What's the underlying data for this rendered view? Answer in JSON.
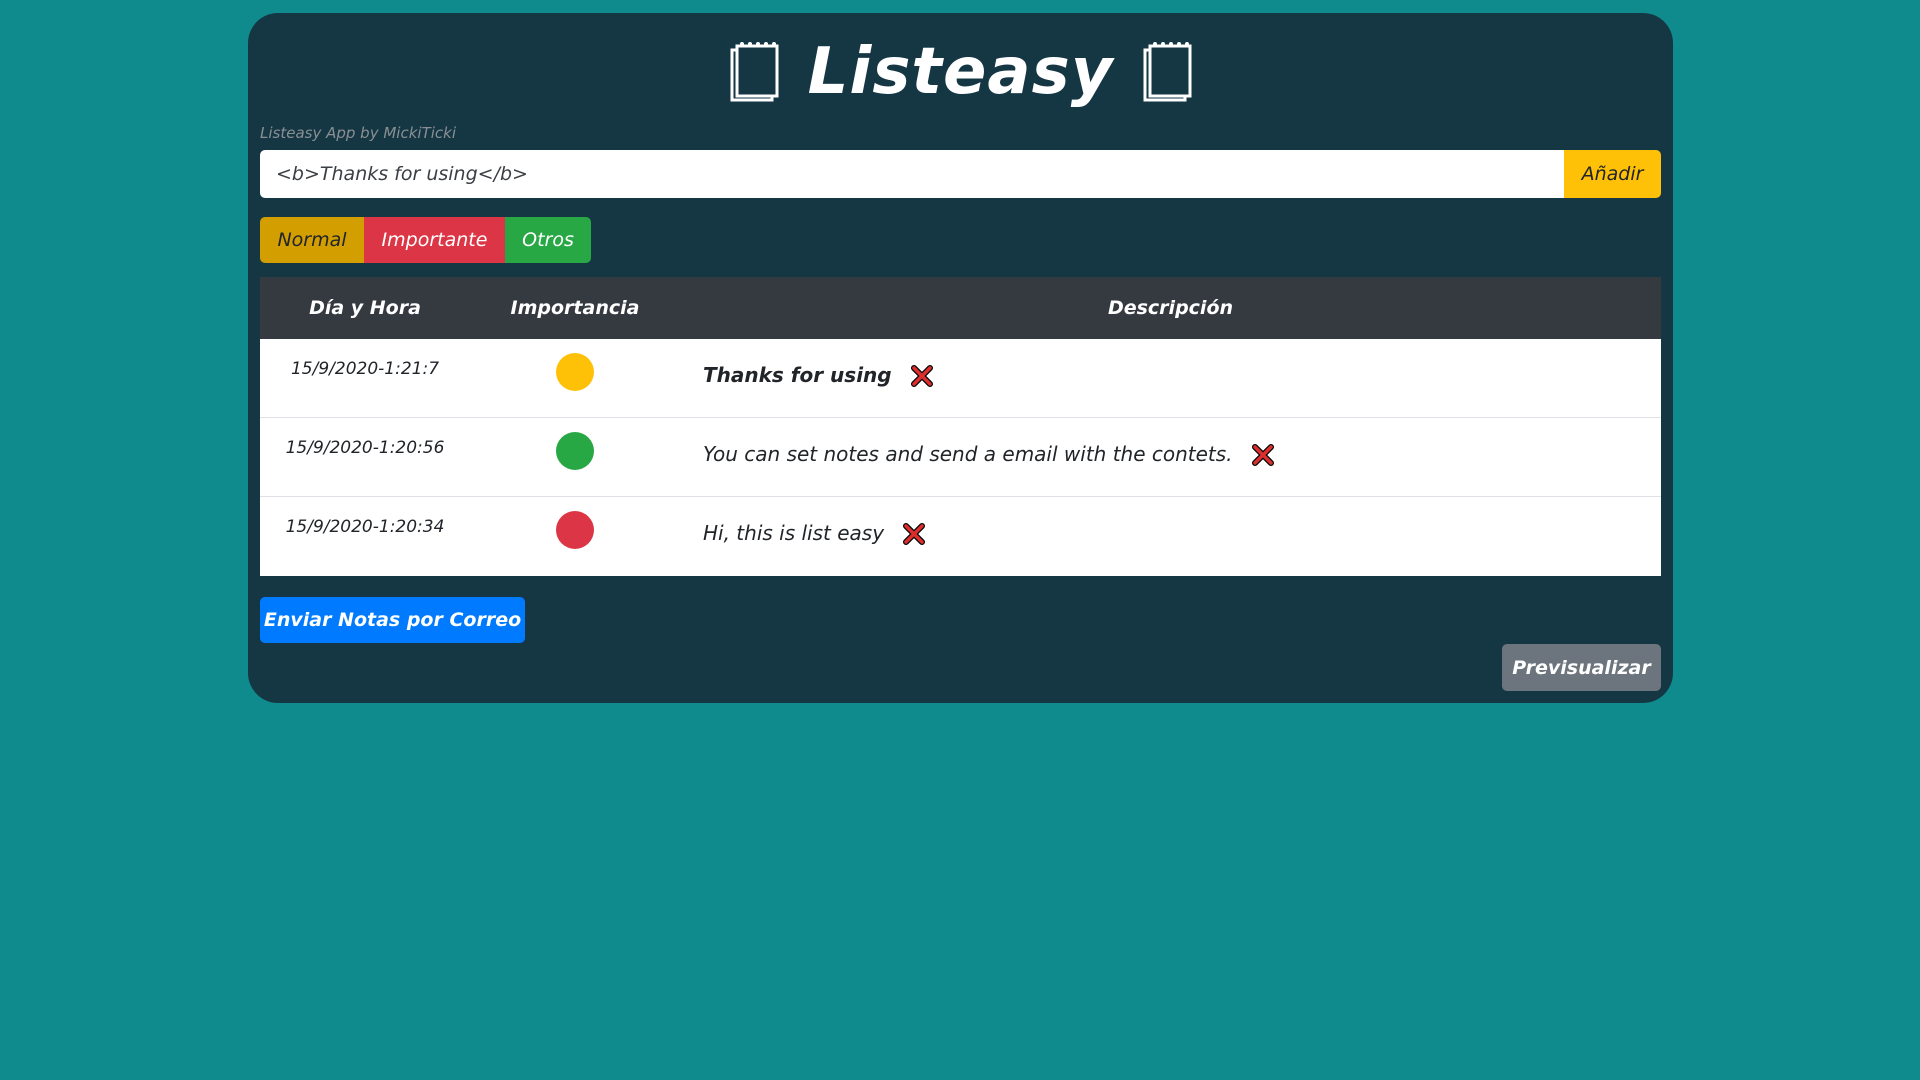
{
  "app": {
    "title": "Listeasy",
    "credit": "Listeasy App by MickiTicki"
  },
  "input": {
    "value": "<b>Thanks for using</b>",
    "add_label": "Añadir"
  },
  "priority_buttons": {
    "normal": "Normal",
    "importante": "Importante",
    "otros": "Otros"
  },
  "table": {
    "headers": {
      "date": "Día y Hora",
      "importance": "Importancia",
      "description": "Descripción"
    },
    "rows": [
      {
        "date": "15/9/2020-1:21:7",
        "importance": "normal",
        "importance_color": "#ffc107",
        "description": "Thanks for using",
        "bold": true
      },
      {
        "date": "15/9/2020-1:20:56",
        "importance": "otros",
        "importance_color": "#28a745",
        "description": "You can set notes and send a email with the contets.",
        "bold": false
      },
      {
        "date": "15/9/2020-1:20:34",
        "importance": "importante",
        "importance_color": "#dc3545",
        "description": "Hi, this is list easy",
        "bold": false
      }
    ]
  },
  "actions": {
    "send_mail": "Enviar Notas por Correo",
    "preview": "Previsualizar"
  },
  "icons": {
    "header_left": "notepad-icon",
    "header_right": "notepad-icon",
    "delete": "cross-mark-icon"
  },
  "colors": {
    "page_bg": "#0f8b8d",
    "card_bg": "#153744",
    "warning": "#ffc107",
    "danger": "#dc3545",
    "success": "#28a745",
    "primary": "#007bff",
    "secondary": "#6c757d"
  }
}
